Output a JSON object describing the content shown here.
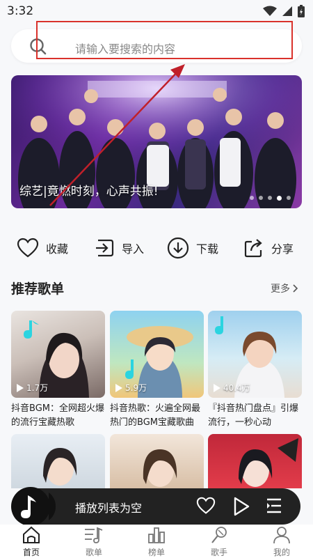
{
  "status_bar": {
    "time": "3:32"
  },
  "search": {
    "placeholder": "请输入要搜索的内容"
  },
  "banner": {
    "caption": "综艺|竟燃时刻，心声共振!",
    "dots": 5,
    "active_dot": 3
  },
  "actions": [
    {
      "label": "收藏",
      "icon": "heart-icon"
    },
    {
      "label": "导入",
      "icon": "import-icon"
    },
    {
      "label": "下载",
      "icon": "download-icon"
    },
    {
      "label": "分享",
      "icon": "share-icon"
    }
  ],
  "section": {
    "title": "推荐歌单",
    "more": "更多"
  },
  "playlists": [
    {
      "plays": "1.7万",
      "title": "抖音BGM：全网超火爆的流行宝藏热歌"
    },
    {
      "plays": "5.9万",
      "title": "抖音热歌：火遍全网最热门的BGM宝藏歌曲"
    },
    {
      "plays": "40.4万",
      "title": "『抖音热门盘点』引爆流行，一秒心动"
    }
  ],
  "mini_player": {
    "text": "播放列表为空"
  },
  "tabs": [
    {
      "label": "首页",
      "icon": "home-icon",
      "active": true
    },
    {
      "label": "歌单",
      "icon": "playlist-icon",
      "active": false
    },
    {
      "label": "榜单",
      "icon": "chart-icon",
      "active": false
    },
    {
      "label": "歌手",
      "icon": "microphone-icon",
      "active": false
    },
    {
      "label": "我的",
      "icon": "user-icon",
      "active": false
    }
  ]
}
